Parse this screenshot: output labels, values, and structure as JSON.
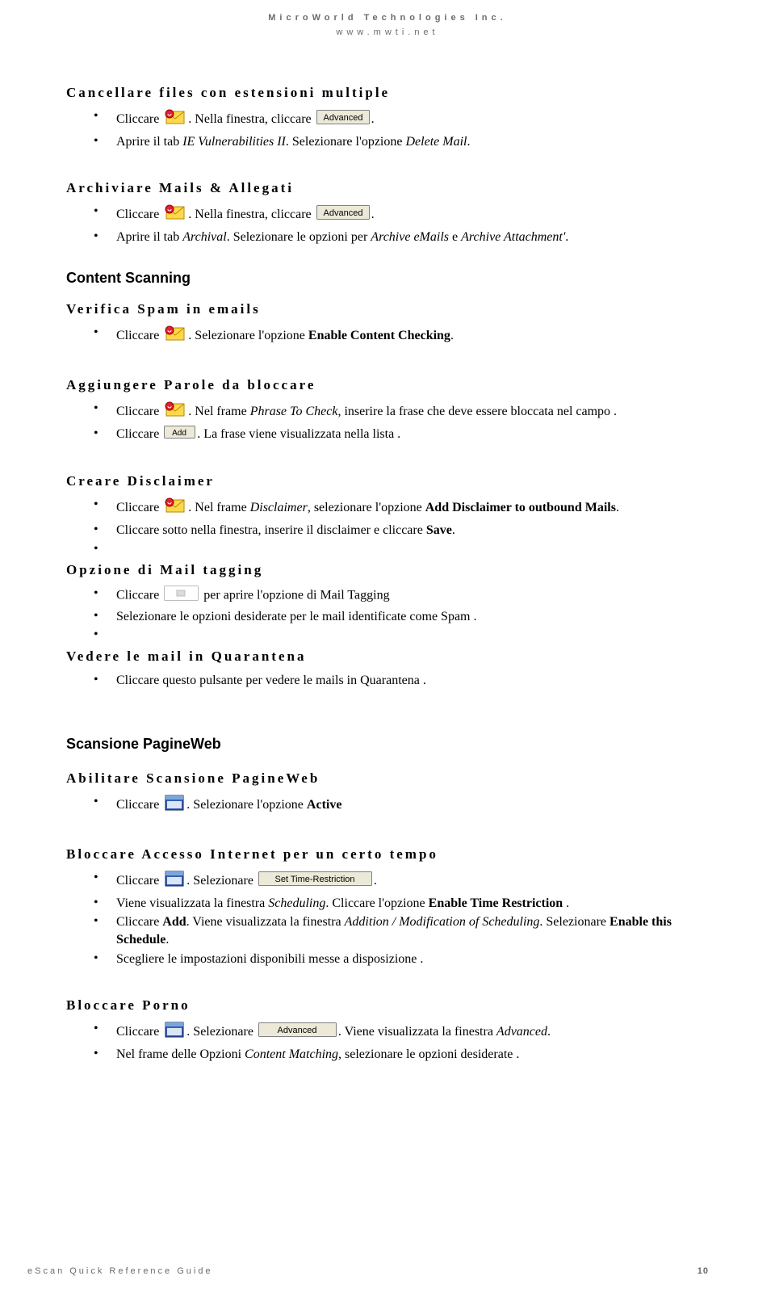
{
  "header": {
    "company": "MicroWorld Technologies Inc.",
    "site": "www.mwti.net"
  },
  "s1": {
    "title": "Cancellare files con estensioni multiple",
    "b1a": "Cliccare ",
    "b1b": ". Nella finestra, cliccare ",
    "b1c": ".",
    "b2a": "Aprire il tab ",
    "b2b": "IE Vulnerabilities II",
    "b2c": ". Selezionare l'opzione ",
    "b2d": "Delete Mail",
    "b2e": "."
  },
  "s2": {
    "title": "Archiviare Mails & Allegati",
    "b1a": "Cliccare ",
    "b1b": ". Nella finestra, cliccare ",
    "b1c": ".",
    "b2a": "Aprire il tab ",
    "b2b": "Archival",
    "b2c": ". Selezionare le opzioni per ",
    "b2d": "Archive eMails",
    "b2e": " e ",
    "b2f": "Archive Attachment'",
    "b2g": "."
  },
  "cs": {
    "title": "Content Scanning"
  },
  "s3": {
    "title": "Verifica Spam in emails",
    "b1a": "Cliccare ",
    "b1b": ". Selezionare l'opzione ",
    "b1c": "Enable Content Checking",
    "b1d": "."
  },
  "s4": {
    "title": "Aggiungere Parole da bloccare",
    "b1a": "Cliccare ",
    "b1b": ". Nel frame ",
    "b1c": "Phrase To Check",
    "b1d": ", inserire la frase che deve essere bloccata nel campo .",
    "b2a": "Cliccare ",
    "b2b": ". La frase viene visualizzata nella lista ."
  },
  "s5": {
    "title": "Creare Disclaimer",
    "b1a": "Cliccare ",
    "b1b": ". Nel frame ",
    "b1c": "Disclaimer",
    "b1d": ", selezionare l'opzione  ",
    "b1e": "Add Disclaimer to outbound Mails",
    "b1f": ".",
    "b2a": "Cliccare sotto nella finestra, inserire il  disclaimer e cliccare ",
    "b2b": "Save",
    "b2c": "."
  },
  "s6": {
    "title": "Opzione di Mail tagging",
    "b1a": "Cliccare ",
    "b1b": " per aprire l'opzione di Mail Tagging",
    "b2": "Selezionare le opzioni desiderate per le mail identificate come Spam ."
  },
  "s7": {
    "title": "Vedere le mail in Quarantena",
    "b1": "Cliccare questo pulsante per vedere le mails in Quarantena ."
  },
  "spw": {
    "title": "Scansione PagineWeb"
  },
  "s8": {
    "title": "Abilitare Scansione PagineWeb",
    "b1a": "Cliccare ",
    "b1b": ". Selezionare l'opzione ",
    "b1c": "Active"
  },
  "s9": {
    "title": "Bloccare Accesso Internet per un certo tempo",
    "b1a": "Cliccare ",
    "b1b": ". Selezionare ",
    "b1c": ".",
    "b2a": "Viene visualizzata la finestra ",
    "b2b": "Scheduling",
    "b2c": ". Cliccare l'opzione ",
    "b2d": "Enable Time Restriction",
    "b2e": " .",
    "b3a": "Cliccare ",
    "b3b": "Add",
    "b3c": ". Viene visualizzata la finestra ",
    "b3d": "Addition / Modification of Scheduling",
    "b3e": ". Selezionare ",
    "b3f": "Enable this Schedule",
    "b3g": ".",
    "b4": "Scegliere le impostazioni disponibili messe a disposizione ."
  },
  "s10": {
    "title": "Bloccare Porno",
    "b1a": "Cliccare ",
    "b1b": ". Selezionare ",
    "b1c": ". Viene visualizzata la finestra ",
    "b1d": "Advanced",
    "b1e": ".",
    "b2a": "Nel frame delle Opzioni ",
    "b2b": "Content Matching",
    "b2c": ", selezionare le opzioni desiderate ."
  },
  "footer": {
    "title": "eScan Quick Reference Guide",
    "page": "10"
  },
  "btn": {
    "advanced": "Advanced",
    "add": "Add",
    "timeRestrict": "Set Time-Restriction"
  }
}
